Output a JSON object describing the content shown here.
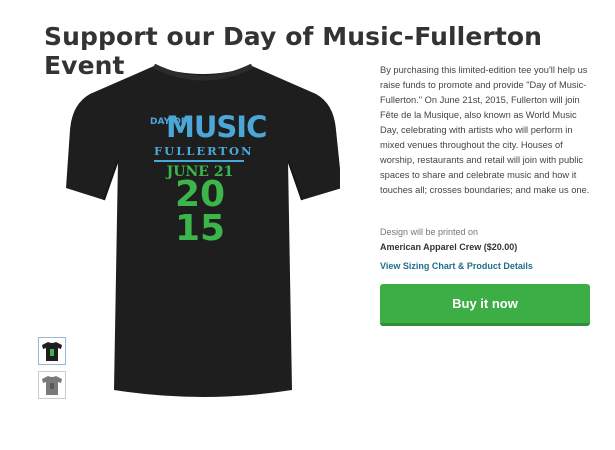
{
  "page": {
    "title": "Support our Day of Music-Fullerton Event"
  },
  "product": {
    "shirt_color": "#1e1e1e",
    "print": {
      "day_of": "DAY OF",
      "music": "MUSIC",
      "city": "FULLERTON",
      "date": "JUNE 21",
      "year_top": "20",
      "year_bottom": "15",
      "blue": "#4aa8d8",
      "green": "#3cb54a"
    },
    "thumbnails": [
      {
        "label": "Black tee",
        "color": "#1e1e1e"
      },
      {
        "label": "Grey tee",
        "color": "#7a7a7a"
      }
    ]
  },
  "details": {
    "description": "By purchasing this limited-edition tee you'll help us raise funds to promote and provide \"Day of Music-Fullerton.\" On June 21st, 2015, Fullerton will join Fête de la Musique, also known as World Music Day, celebrating with artists who will perform in mixed venues throughout the city. Houses of worship, restaurants and retail will join with public spaces to share and celebrate music and how it touches all; crosses boundaries; and make us one.",
    "printed_label": "Design will be printed on",
    "product_line": "American Apparel Crew ($20.00)",
    "sizing_link": "View Sizing Chart & Product Details",
    "buy_label": "Buy it now",
    "accent": "#3dae46"
  }
}
